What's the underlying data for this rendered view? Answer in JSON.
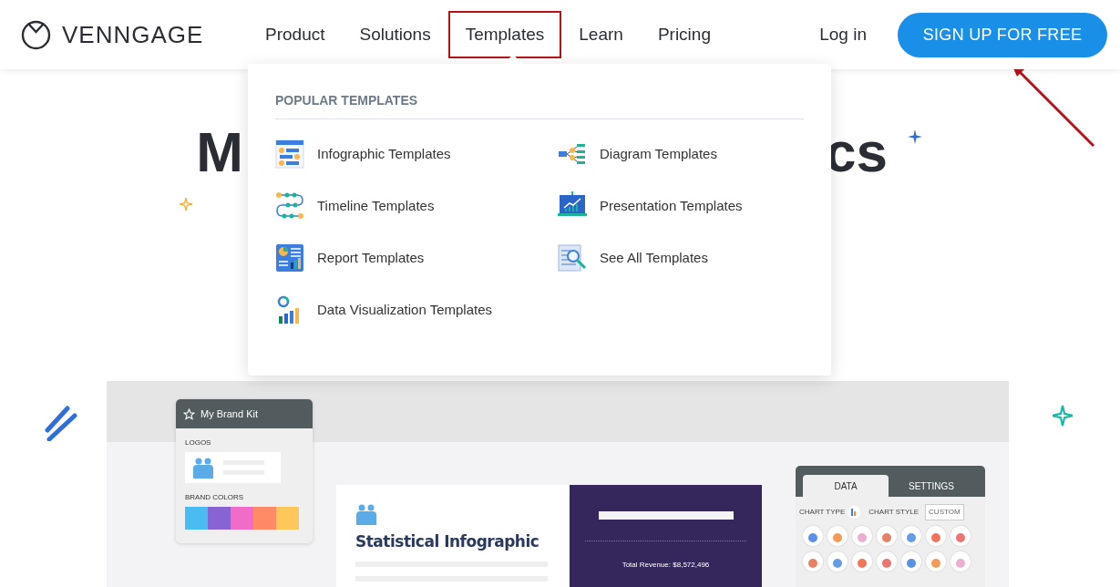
{
  "header": {
    "logo": "VENNGAGE",
    "nav": [
      {
        "label": "Product",
        "selected": false
      },
      {
        "label": "Solutions",
        "selected": false
      },
      {
        "label": "Templates",
        "selected": true
      },
      {
        "label": "Learn",
        "selected": false
      },
      {
        "label": "Pricing",
        "selected": false
      }
    ],
    "login": "Log in",
    "signup": "SIGN UP FOR FREE"
  },
  "hero": {
    "title_left": "M",
    "title_right": "cs"
  },
  "dropdown": {
    "heading": "POPULAR TEMPLATES",
    "items": [
      {
        "label": "Infographic Templates",
        "kind": "infographic"
      },
      {
        "label": "Diagram Templates",
        "kind": "diagram"
      },
      {
        "label": "Timeline Templates",
        "kind": "timeline"
      },
      {
        "label": "Presentation Templates",
        "kind": "presentation"
      },
      {
        "label": "Report Templates",
        "kind": "report"
      },
      {
        "label": "See All Templates",
        "kind": "search"
      },
      {
        "label": "Data Visualization Templates",
        "kind": "dataviz"
      }
    ]
  },
  "mockup": {
    "brand_kit": {
      "title": "My Brand Kit",
      "logos_label": "LOGOS",
      "colors_label": "BRAND COLORS",
      "colors": [
        {
          "color": "#4bbcf2"
        },
        {
          "color": "#8a63d2"
        },
        {
          "color": "#f06cc8"
        },
        {
          "color": "#ff8a65"
        },
        {
          "color": "#ffc65c"
        }
      ]
    },
    "document": {
      "title": "Statistical Infographic",
      "revenue": "Total Revenue: $8,572,496"
    },
    "chart_panel": {
      "tabs": [
        {
          "label": "DATA",
          "selected": true
        },
        {
          "label": "SETTINGS",
          "selected": false
        }
      ],
      "chart_type": "CHART TYPE",
      "chart_style": "CHART STYLE",
      "custom": "CUSTOM"
    }
  }
}
